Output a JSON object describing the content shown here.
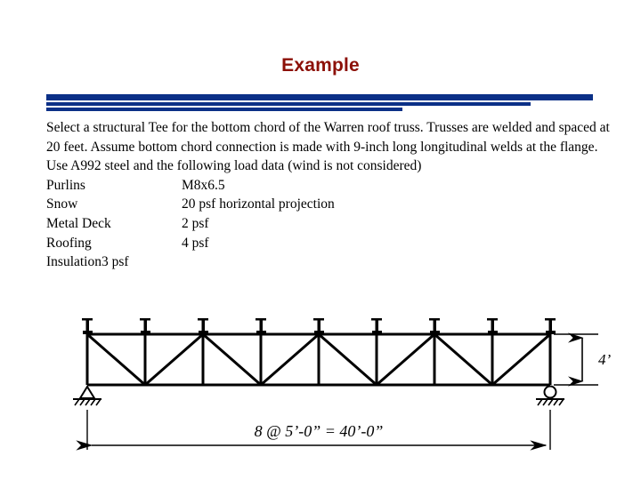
{
  "slide": {
    "title": "Example",
    "title_color": "#8c1008",
    "accent_color": "#0b3087",
    "background_color": "#ffffff"
  },
  "body": {
    "paragraph": "Select a structural Tee for the bottom chord of the Warren roof truss.  Trusses are welded and spaced at 20 feet.  Assume bottom chord connection is made with 9-inch long longitudinal welds at the flange.  Use A992 steel and the following load data (wind is not considered)",
    "load_rows": [
      {
        "label": "Purlins",
        "value": "M8x6.5"
      },
      {
        "label": "Snow",
        "value": "20 psf horizontal projection"
      },
      {
        "label": "Metal Deck",
        "value": "2 psf"
      },
      {
        "label": "Roofing",
        "value": "4 psf"
      },
      {
        "label": "Insulation3 psf",
        "value": ""
      }
    ]
  },
  "figure": {
    "name": "warren-roof-truss-elevation",
    "depth_label": "4’",
    "span_label": "8 @ 5’-0” = 40’-0”",
    "panels": 8,
    "panel_length": "5'-0\"",
    "span": "40'-0\"",
    "depth": "4'",
    "purlin_count": 9,
    "left_support": "pin",
    "right_support": "roller"
  }
}
